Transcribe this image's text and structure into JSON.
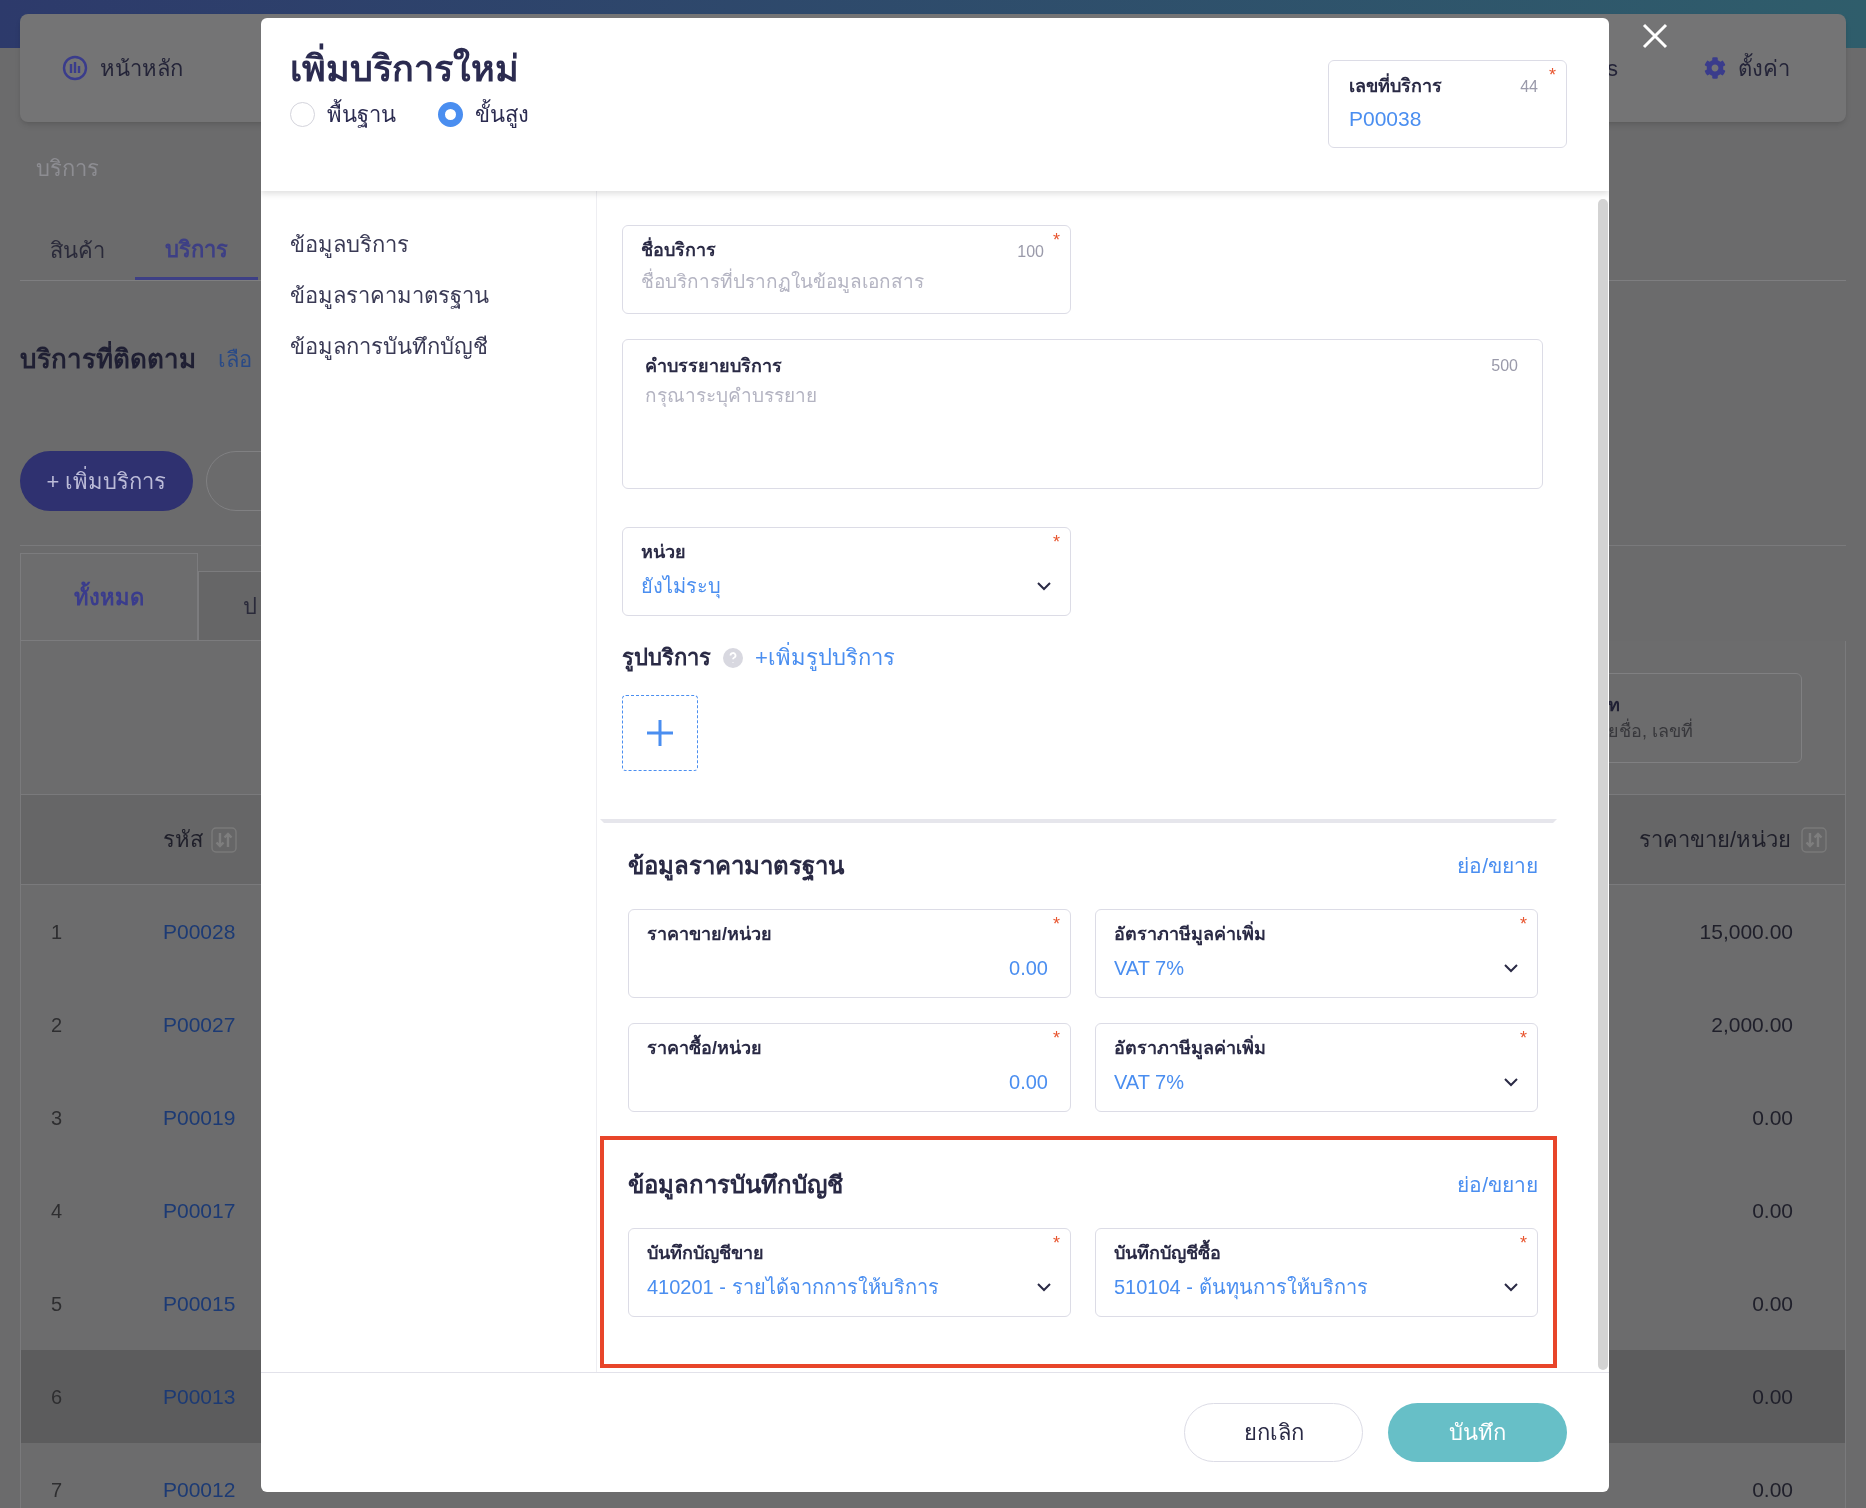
{
  "top_nav": {
    "home": "หน้าหลัก",
    "partial_item": "s",
    "settings": "ตั้งค่า"
  },
  "breadcrumb": "บริการ",
  "tabs": [
    {
      "label": "สินค้า",
      "selected": false
    },
    {
      "label": "บริการ",
      "selected": true
    }
  ],
  "followed": {
    "title": "บริการที่ติดตาม",
    "link": "เลือ"
  },
  "add_button": "+ เพิ่มบริการ",
  "list_tabs": [
    {
      "label": "ทั้งหมด",
      "selected": true
    },
    {
      "label": "ป",
      "selected": false
    }
  ],
  "search": {
    "label": "ท",
    "placeholder": "ยชื่อ, เลขที่"
  },
  "table": {
    "columns": [
      {
        "label": "รหัส"
      },
      {
        "label": "ราคาขาย/หน่วย"
      }
    ],
    "rows": [
      {
        "index": "1",
        "code": "P00028",
        "price": "15,000.00",
        "highlighted": false
      },
      {
        "index": "2",
        "code": "P00027",
        "price": "2,000.00",
        "highlighted": false
      },
      {
        "index": "3",
        "code": "P00019",
        "price": "0.00",
        "highlighted": false
      },
      {
        "index": "4",
        "code": "P00017",
        "price": "0.00",
        "highlighted": false
      },
      {
        "index": "5",
        "code": "P00015",
        "price": "0.00",
        "highlighted": false
      },
      {
        "index": "6",
        "code": "P00013",
        "price": "0.00",
        "highlighted": true
      },
      {
        "index": "7",
        "code": "P00012",
        "price": "0.00",
        "highlighted": false
      }
    ]
  },
  "modal": {
    "title": "เพิ่มบริการใหม่",
    "modes": [
      {
        "label": "พื้นฐาน",
        "selected": false
      },
      {
        "label": "ขั้นสูง",
        "selected": true
      }
    ],
    "service_number": {
      "label": "เลขที่บริการ",
      "count": "44",
      "required_mark": "*",
      "value": "P00038"
    },
    "nav": [
      "ข้อมูลบริการ",
      "ข้อมูลราคามาตรฐาน",
      "ข้อมูลการบันทึกบัญชี"
    ],
    "service_info": {
      "name_field": {
        "label": "ชื่อบริการ",
        "count": "100",
        "required_mark": "*",
        "placeholder": "ชื่อบริการที่ปรากฏในข้อมูลเอกสาร"
      },
      "description_field": {
        "label": "คำบรรยายบริการ",
        "count": "500",
        "placeholder": "กรุณาระบุคำบรรยาย"
      },
      "unit_field": {
        "label": "หน่วย",
        "required_mark": "*",
        "value": "ยังไม่ระบุ"
      },
      "image": {
        "label": "รูปบริการ",
        "add_link": "+เพิ่มรูปบริการ"
      }
    },
    "sections": [
      {
        "title": "ข้อมูลราคามาตรฐาน",
        "toggle": "ย่อ/ขยาย",
        "highlighted": false,
        "fields": [
          {
            "kind": "number",
            "label": "ราคาขาย/หน่วย",
            "required_mark": "*",
            "value": "0.00"
          },
          {
            "kind": "select",
            "label": "อัตราภาษีมูลค่าเพิ่ม",
            "required_mark": "*",
            "value": "VAT 7%"
          },
          {
            "kind": "number",
            "label": "ราคาซื้อ/หน่วย",
            "required_mark": "*",
            "value": "0.00"
          },
          {
            "kind": "select",
            "label": "อัตราภาษีมูลค่าเพิ่ม",
            "required_mark": "*",
            "value": "VAT 7%"
          }
        ]
      },
      {
        "title": "ข้อมูลการบันทึกบัญชี",
        "toggle": "ย่อ/ขยาย",
        "highlighted": true,
        "fields": [
          {
            "kind": "select",
            "label": "บันทึกบัญชีขาย",
            "required_mark": "*",
            "value": "410201 - รายได้จากการให้บริการ"
          },
          {
            "kind": "select",
            "label": "บันทึกบัญชีซื้อ",
            "required_mark": "*",
            "value": "510104 - ต้นทุนการให้บริการ"
          }
        ]
      }
    ],
    "buttons": [
      {
        "label": "ยกเลิก",
        "kind": "secondary"
      },
      {
        "label": "บันทึก",
        "kind": "primary"
      }
    ]
  }
}
